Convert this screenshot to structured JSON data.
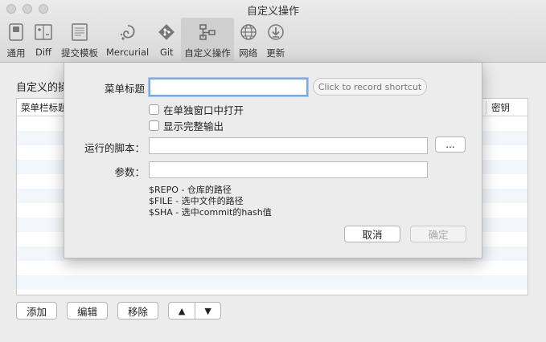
{
  "window": {
    "title": "自定义操作"
  },
  "toolbar": {
    "items": [
      {
        "label": "通用",
        "icon": "switch-icon"
      },
      {
        "label": "Diff",
        "icon": "diff-icon"
      },
      {
        "label": "提交模板",
        "icon": "document-icon"
      },
      {
        "label": "Mercurial",
        "icon": "mercurial-icon"
      },
      {
        "label": "Git",
        "icon": "git-icon"
      },
      {
        "label": "自定义操作",
        "icon": "custom-actions-icon",
        "active": true
      },
      {
        "label": "网络",
        "icon": "globe-icon"
      },
      {
        "label": "更新",
        "icon": "download-icon"
      }
    ]
  },
  "main": {
    "section_label": "自定义的操作",
    "table": {
      "columns": [
        "菜单栏标题",
        "密钥"
      ]
    },
    "buttons": {
      "add": "添加",
      "edit": "编辑",
      "remove": "移除",
      "up": "▲",
      "down": "▼"
    }
  },
  "dialog": {
    "menu_title_label": "菜单标题",
    "menu_title_value": "",
    "shortcut_placeholder": "Click to record shortcut",
    "open_in_window": "在单独窗口中打开",
    "show_full_output": "显示完整输出",
    "script_label": "运行的脚本：",
    "script_value": "",
    "browse_label": "...",
    "params_label": "参数：",
    "params_value": "",
    "help_lines": [
      "$REPO - 仓库的路径",
      "$FILE - 选中文件的路径",
      "$SHA - 选中commit的hash值"
    ],
    "cancel_label": "取消",
    "ok_label": "确定"
  }
}
